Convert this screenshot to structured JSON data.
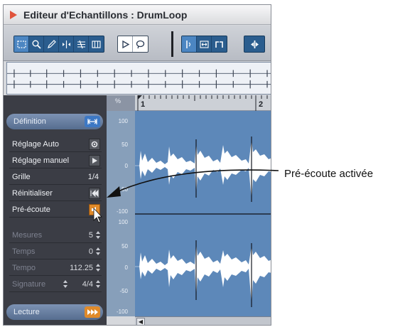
{
  "window": {
    "title": "Editeur d'Echantillons : DrumLoop"
  },
  "toolbar": {
    "group1_icons": [
      "range-select-icon",
      "zoom-icon",
      "pencil-icon",
      "play-tool-icon",
      "scrub-icon",
      "grid-icon"
    ],
    "group2_icons": [
      "play-icon",
      "loop-icon"
    ],
    "group3_icons": [
      "audition-icon",
      "snap-icon",
      "hitpoint-icon"
    ],
    "group4_icons": [
      "insert-icon"
    ]
  },
  "inspector": {
    "definition_label": "Définition",
    "rows": [
      {
        "label": "Réglage Auto",
        "control": "gear-icon"
      },
      {
        "label": "Réglage manuel",
        "control": "play-arrow-icon"
      },
      {
        "label": "Grille",
        "value": "1/4"
      },
      {
        "label": "Réinitialiser",
        "control": "reset-icon"
      },
      {
        "label": "Pré-écoute",
        "control": "speaker-icon"
      }
    ],
    "dim_rows": [
      {
        "label": "Mesures",
        "value": "5"
      },
      {
        "label": "Temps",
        "value": "0"
      },
      {
        "label": "Tempo",
        "value": "112.25"
      },
      {
        "label": "Signature",
        "value": "4/4"
      }
    ],
    "playback_label": "Lecture"
  },
  "ruler": {
    "corner_label": "%",
    "marks": [
      "1",
      "2"
    ]
  },
  "yscale": {
    "upper": [
      "100",
      "50",
      "0",
      "-50",
      "-100"
    ],
    "lower": [
      "100",
      "50",
      "0",
      "-50",
      "-100"
    ]
  },
  "annotation": {
    "text": "Pré-écoute activée"
  },
  "colors": {
    "accent_blue": "#3d78c4",
    "accent_orange": "#e08a2a",
    "wave_bg": "#5d88b9"
  }
}
